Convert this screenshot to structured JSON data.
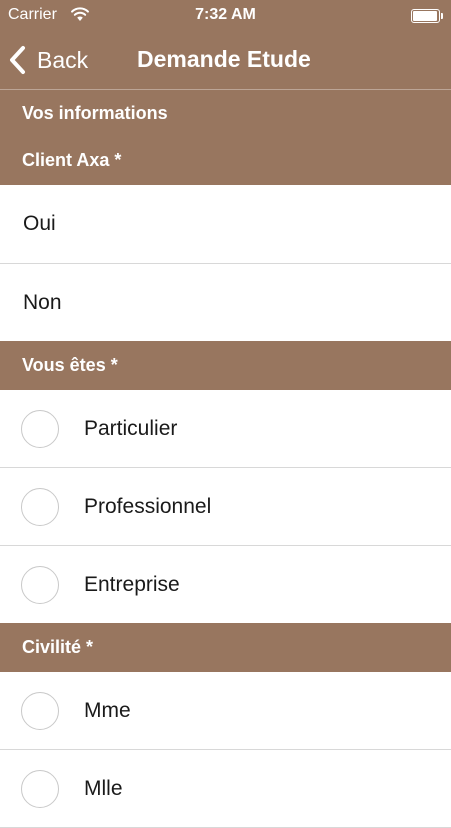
{
  "status_bar": {
    "carrier": "Carrier",
    "time": "7:32 AM"
  },
  "nav": {
    "back_label": "Back",
    "title": "Demande Etude"
  },
  "sections": {
    "info": {
      "header": "Vos informations"
    },
    "client": {
      "header": "Client Axa *",
      "options": [
        "Oui",
        "Non"
      ]
    },
    "type": {
      "header": "Vous êtes *",
      "options": [
        "Particulier",
        "Professionnel",
        "Entreprise"
      ]
    },
    "civilite": {
      "header": "Civilité *",
      "options": [
        "Mme",
        "Mlle"
      ]
    }
  },
  "colors": {
    "accent": "#98765f",
    "separator": "#d8d8d8",
    "radio_border": "#c9c9c9"
  },
  "icons": {
    "back": "chevron-left-icon",
    "wifi": "wifi-icon",
    "battery": "battery-icon"
  }
}
